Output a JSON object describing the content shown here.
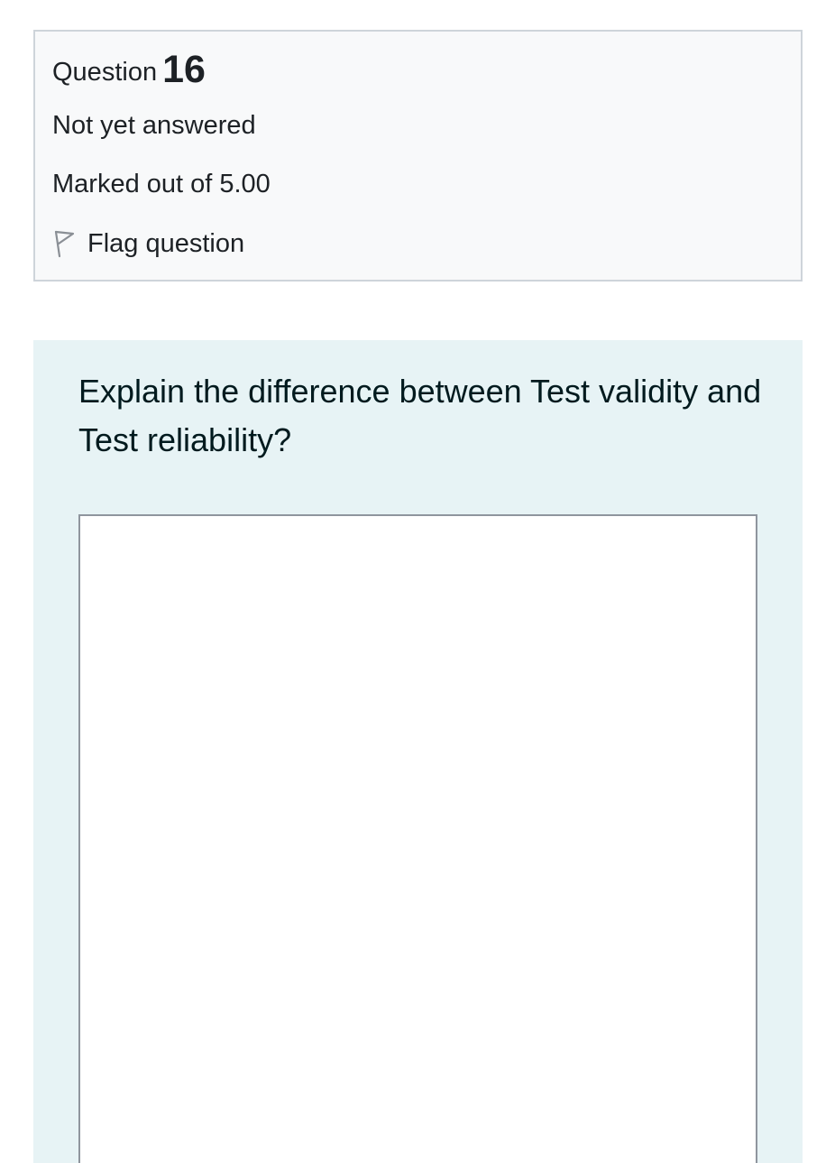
{
  "question_info": {
    "label": "Question",
    "number": "16",
    "state": "Not yet answered",
    "grade": "Marked out of 5.00",
    "flag_label": "Flag question",
    "flag_icon": "flag-outline-icon"
  },
  "question": {
    "text": "Explain the difference between Test validity and Test reliability?",
    "answer_value": ""
  },
  "colors": {
    "info_bg": "#f8f9fa",
    "info_border": "#ced4da",
    "content_bg": "#e7f3f5",
    "textarea_border": "#8f959e"
  }
}
